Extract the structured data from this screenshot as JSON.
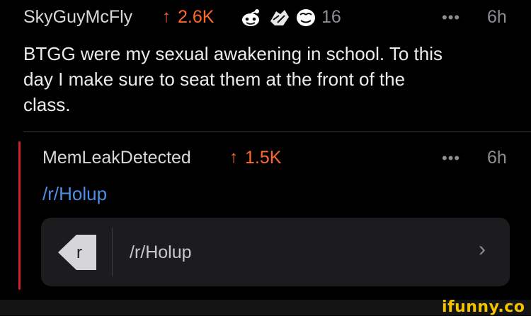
{
  "comment": {
    "username": "SkyGuyMcFly",
    "score": "2.6K",
    "award_count": "16",
    "time": "6h",
    "body_lines": [
      "BTGG were my sexual awakening in school. To this",
      "day I make sure to seat them at the front of the",
      "class."
    ],
    "awards": [
      "reddit-gold-award-icon",
      "wholesome-seal-award-icon",
      "face-award-icon"
    ]
  },
  "reply": {
    "username": "MemLeakDetected",
    "score": "1.5K",
    "time": "6h",
    "link": "/r/Holup",
    "card_label": "/r/Holup",
    "card_badge": "r"
  },
  "watermark": "ifunny.co",
  "colors": {
    "upvote": "#ff6a2b",
    "link": "#4d8fe6",
    "thread": "#d0202a",
    "watermark": "#f5c400"
  }
}
